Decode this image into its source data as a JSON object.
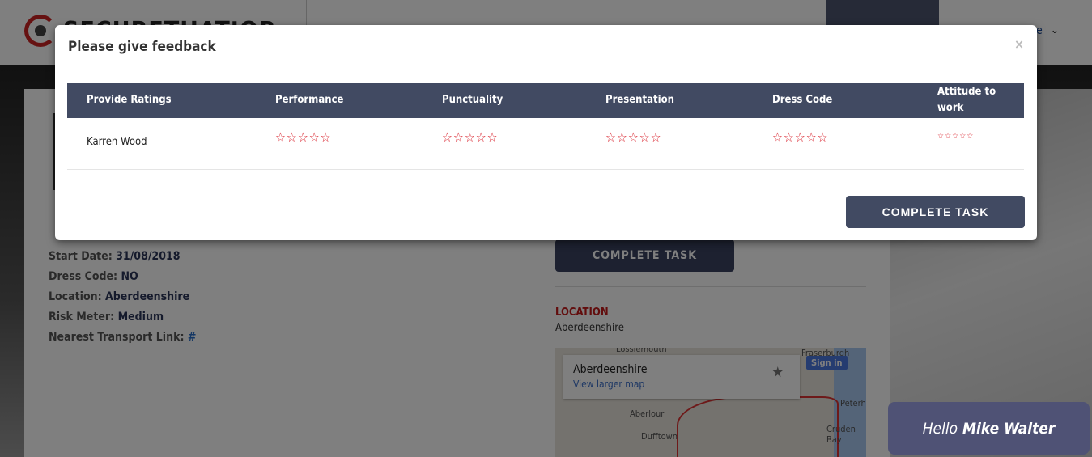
{
  "header": {
    "logo_text": "SECURETHATJOB",
    "user_menu_partial": "e"
  },
  "page": {
    "details": [
      {
        "label": "Start Date:",
        "value": "31/08/2018"
      },
      {
        "label": "Dress Code:",
        "value": "NO"
      },
      {
        "label": "Location:",
        "value": "Aberdeenshire"
      },
      {
        "label": "Risk Meter:",
        "value": "Medium"
      },
      {
        "label": "Nearest Transport Link:",
        "value": "#"
      }
    ],
    "complete_task_label": "COMPLETE TASK",
    "location_heading": "LOCATION",
    "location_value": "Aberdeenshire",
    "map": {
      "place": "Aberdeenshire",
      "view_larger": "View larger map",
      "sign_in": "Sign in",
      "labels": [
        "Lossiemouth",
        "Fraserburgh",
        "Aberlour",
        "Dufftown",
        "Peterhead",
        "Cruden Bay"
      ]
    }
  },
  "modal": {
    "title": "Please give feedback",
    "close": "×",
    "columns": [
      "Provide Ratings",
      "Performance",
      "Punctuality",
      "Presentation",
      "Dress Code",
      "Attitude to work"
    ],
    "rows": [
      {
        "name": "Karren Wood",
        "ratings": [
          0,
          0,
          0,
          0,
          0
        ],
        "max": 5
      }
    ],
    "star_glyph": "☆☆☆☆☆",
    "button": "COMPLETE TASK",
    "accent": "#414a62",
    "star_color": "#d9232d"
  },
  "chat": {
    "greeting": "Hello",
    "name": "Mike Walter"
  }
}
